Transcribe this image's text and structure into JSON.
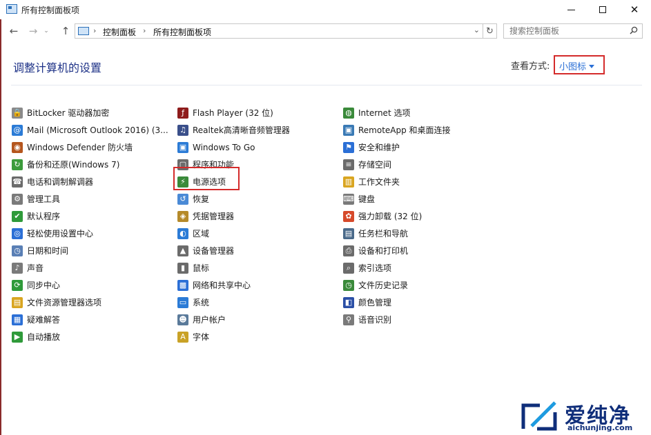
{
  "window": {
    "title": "所有控制面板项"
  },
  "nav": {
    "breadcrumbs": [
      "控制面板",
      "所有控制面板项"
    ],
    "search_placeholder": "搜索控制面板"
  },
  "main": {
    "heading": "调整计算机的设置",
    "view_label": "查看方式:",
    "view_value": "小图标"
  },
  "columns": [
    [
      {
        "label": "BitLocker 驱动器加密",
        "icon": "bitlocker-icon",
        "glyph": "🔒",
        "color": "#8a8a8a"
      },
      {
        "label": "Mail (Microsoft Outlook 2016) (3...",
        "icon": "mail-icon",
        "glyph": "@",
        "color": "#2b7bd6"
      },
      {
        "label": "Windows Defender 防火墙",
        "icon": "firewall-icon",
        "glyph": "◉",
        "color": "#b5561e"
      },
      {
        "label": "备份和还原(Windows 7)",
        "icon": "backup-icon",
        "glyph": "↻",
        "color": "#3c9b3c"
      },
      {
        "label": "电话和调制解调器",
        "icon": "phone-modem-icon",
        "glyph": "☎",
        "color": "#6b6b6b"
      },
      {
        "label": "管理工具",
        "icon": "admin-tools-icon",
        "glyph": "⚙",
        "color": "#7a7a7a"
      },
      {
        "label": "默认程序",
        "icon": "default-programs-icon",
        "glyph": "✔",
        "color": "#2f9a3a"
      },
      {
        "label": "轻松使用设置中心",
        "icon": "ease-of-access-icon",
        "glyph": "◎",
        "color": "#2b6fd6"
      },
      {
        "label": "日期和时间",
        "icon": "clock-icon",
        "glyph": "◷",
        "color": "#5a7fb5"
      },
      {
        "label": "声音",
        "icon": "speaker-icon",
        "glyph": "♪",
        "color": "#7a7a7a"
      },
      {
        "label": "同步中心",
        "icon": "sync-icon",
        "glyph": "⟳",
        "color": "#2f9a3a"
      },
      {
        "label": "文件资源管理器选项",
        "icon": "folder-options-icon",
        "glyph": "▤",
        "color": "#d9a520"
      },
      {
        "label": "疑难解答",
        "icon": "troubleshoot-icon",
        "glyph": "▦",
        "color": "#2b6fd6"
      },
      {
        "label": "自动播放",
        "icon": "autoplay-icon",
        "glyph": "▶",
        "color": "#2f9a3a"
      }
    ],
    [
      {
        "label": "Flash Player (32 位)",
        "icon": "flash-icon",
        "glyph": "ƒ",
        "color": "#8e1b1b"
      },
      {
        "label": "Realtek高清晰音频管理器",
        "icon": "realtek-audio-icon",
        "glyph": "♫",
        "color": "#3a4f8a"
      },
      {
        "label": "Windows To Go",
        "icon": "windows-to-go-icon",
        "glyph": "▣",
        "color": "#2b7bd6"
      },
      {
        "label": "程序和功能",
        "icon": "programs-features-icon",
        "glyph": "▢",
        "color": "#6b6b6b"
      },
      {
        "label": "电源选项",
        "icon": "power-options-icon",
        "glyph": "⚡",
        "color": "#3a8a3a"
      },
      {
        "label": "恢复",
        "icon": "recovery-icon",
        "glyph": "↺",
        "color": "#4a8ad6"
      },
      {
        "label": "凭据管理器",
        "icon": "credential-manager-icon",
        "glyph": "◈",
        "color": "#b58a2a"
      },
      {
        "label": "区域",
        "icon": "region-icon",
        "glyph": "◐",
        "color": "#2b7bd6"
      },
      {
        "label": "设备管理器",
        "icon": "device-manager-icon",
        "glyph": "▲",
        "color": "#6b6b6b"
      },
      {
        "label": "鼠标",
        "icon": "mouse-icon",
        "glyph": "▮",
        "color": "#6b6b6b"
      },
      {
        "label": "网络和共享中心",
        "icon": "network-sharing-icon",
        "glyph": "▩",
        "color": "#2b6fd6"
      },
      {
        "label": "系统",
        "icon": "system-icon",
        "glyph": "▭",
        "color": "#2b7bd6"
      },
      {
        "label": "用户帐户",
        "icon": "user-accounts-icon",
        "glyph": "☻",
        "color": "#5a7a9a"
      },
      {
        "label": "字体",
        "icon": "fonts-icon",
        "glyph": "A",
        "color": "#c9a227"
      }
    ],
    [
      {
        "label": "Internet 选项",
        "icon": "internet-options-icon",
        "glyph": "◍",
        "color": "#3a8a3a"
      },
      {
        "label": "RemoteApp 和桌面连接",
        "icon": "remoteapp-icon",
        "glyph": "▣",
        "color": "#3a7ab5"
      },
      {
        "label": "安全和维护",
        "icon": "security-flag-icon",
        "glyph": "⚑",
        "color": "#2b6fd6"
      },
      {
        "label": "存储空间",
        "icon": "storage-spaces-icon",
        "glyph": "≡",
        "color": "#6b6b6b"
      },
      {
        "label": "工作文件夹",
        "icon": "work-folders-icon",
        "glyph": "▥",
        "color": "#d9a520"
      },
      {
        "label": "键盘",
        "icon": "keyboard-icon",
        "glyph": "⌨",
        "color": "#7a7a7a"
      },
      {
        "label": "强力卸载 (32 位)",
        "icon": "uninstaller-icon",
        "glyph": "✿",
        "color": "#d64a2b"
      },
      {
        "label": "任务栏和导航",
        "icon": "taskbar-icon",
        "glyph": "▤",
        "color": "#4a6a8a"
      },
      {
        "label": "设备和打印机",
        "icon": "devices-printers-icon",
        "glyph": "⎙",
        "color": "#6b6b6b"
      },
      {
        "label": "索引选项",
        "icon": "indexing-icon",
        "glyph": "⌕",
        "color": "#6b6b6b"
      },
      {
        "label": "文件历史记录",
        "icon": "file-history-icon",
        "glyph": "◷",
        "color": "#3a8a3a"
      },
      {
        "label": "颜色管理",
        "icon": "color-management-icon",
        "glyph": "◧",
        "color": "#2b4fa6"
      },
      {
        "label": "语音识别",
        "icon": "microphone-icon",
        "glyph": "⚲",
        "color": "#7a7a7a"
      }
    ]
  ],
  "watermark": {
    "text": "爱纯净",
    "url": "aichunjing.com"
  }
}
